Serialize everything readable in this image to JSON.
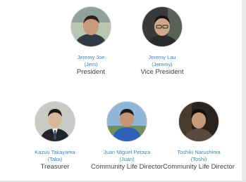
{
  "members": [
    {
      "name": "Jeremy Joe",
      "nickname": "(Jem)",
      "role": "President",
      "avatar_icon": "person-photo-icon"
    },
    {
      "name": "Jeremy Lau",
      "nickname": "(Jeremy)",
      "role": "Vice President",
      "avatar_icon": "person-photo-icon"
    },
    {
      "name": "Kazuu Takayama",
      "nickname": "(Taka)",
      "role": "Treasurer",
      "avatar_icon": "person-photo-icon"
    },
    {
      "name": "Juan Miguel Peraza",
      "nickname": "(Juan)",
      "role": "Community Life Director",
      "avatar_icon": "person-photo-icon"
    },
    {
      "name": "Toshiki Narushima",
      "nickname": "(Toshi)",
      "role": "Community Life Director",
      "avatar_icon": "person-photo-icon"
    }
  ],
  "colors": {
    "name": "#3f86c8",
    "role": "#444444",
    "background": "#ffffff"
  }
}
